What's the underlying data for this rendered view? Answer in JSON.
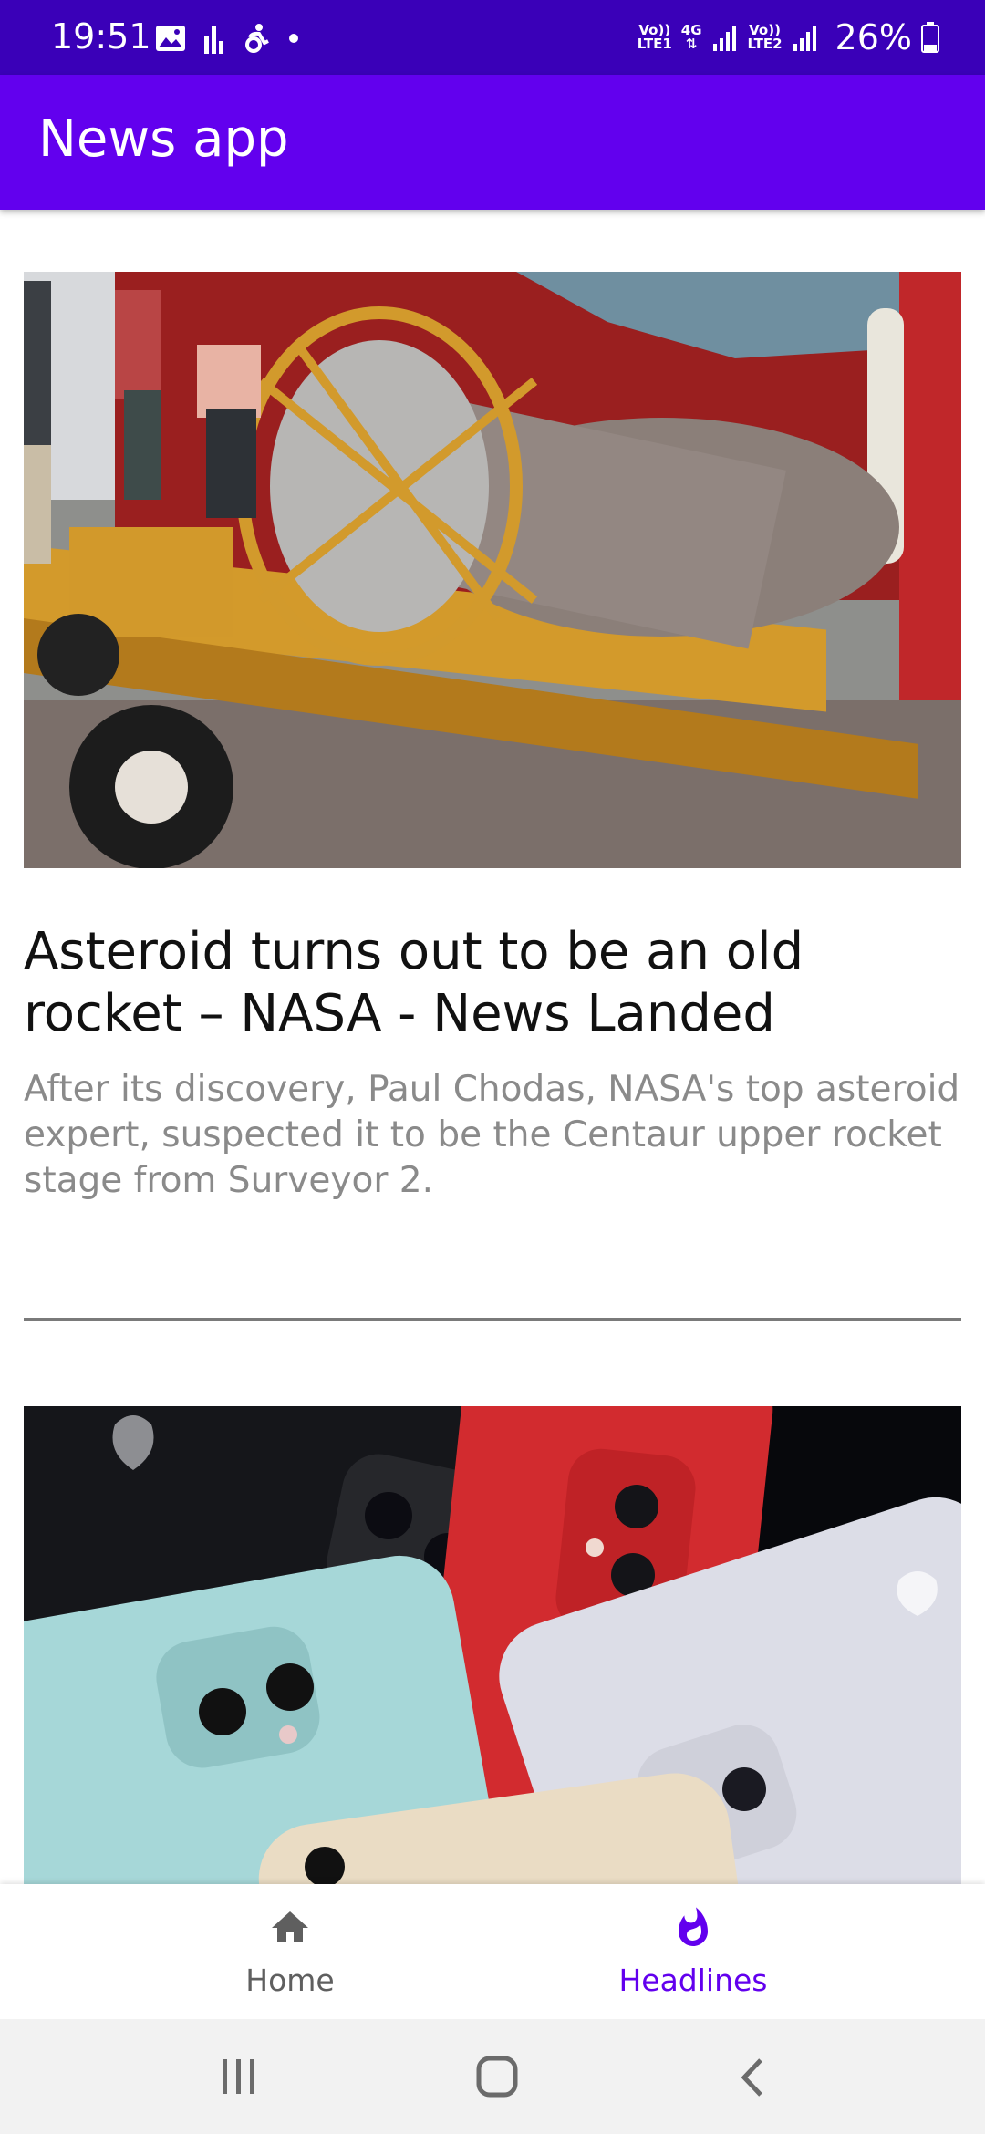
{
  "status_bar": {
    "time": "19:51",
    "sim1_volte": "Vo))",
    "sim1_label": "LTE1",
    "network_type": "4G",
    "sim2_volte": "Vo))",
    "sim2_label": "LTE2",
    "battery": "26%",
    "battery_level": 0.26,
    "colors": {
      "background": "#3a00b8"
    }
  },
  "app_bar": {
    "title": "News app",
    "colors": {
      "background": "#6200ee"
    }
  },
  "articles": [
    {
      "title": "Asteroid turns out to be an old rocket – NASA - News Landed",
      "description": "After its discovery, Paul Chodas, NASA's top asteroid expert, suspected it to be the Centaur upper rocket stage from Surveyor 2.",
      "image": "rocket-stage-on-truck-photo"
    },
    {
      "title": "",
      "description": "",
      "image": "iphone-11-colors-photo"
    }
  ],
  "bottom_nav": {
    "items": [
      {
        "label": "Home",
        "icon": "home-icon",
        "active": false
      },
      {
        "label": "Headlines",
        "icon": "flame-icon",
        "active": true
      }
    ],
    "colors": {
      "active": "#6200ee",
      "inactive": "#5f5f5f"
    }
  },
  "system_nav": {
    "icons": [
      "recent-apps-icon",
      "home-circle-icon",
      "back-icon"
    ]
  }
}
